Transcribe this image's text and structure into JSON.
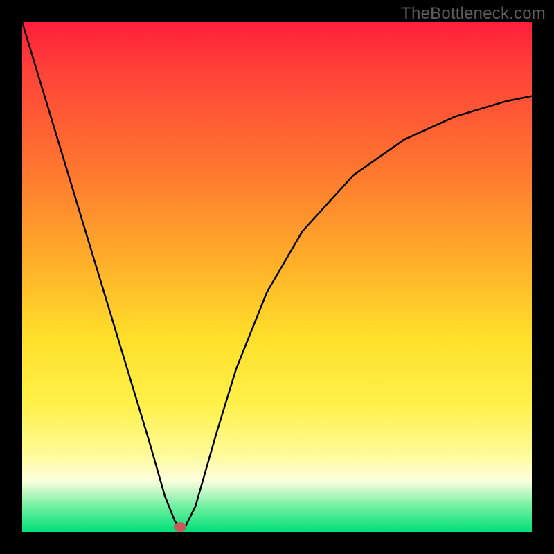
{
  "watermark": "TheBottleneck.com",
  "marker": {
    "x_frac": 0.31,
    "y_frac": 0.99
  },
  "chart_data": {
    "type": "line",
    "title": "",
    "xlabel": "",
    "ylabel": "",
    "xlim": [
      0,
      1
    ],
    "ylim": [
      0,
      1
    ],
    "series": [
      {
        "name": "curve",
        "x": [
          0.0,
          0.05,
          0.1,
          0.15,
          0.2,
          0.25,
          0.28,
          0.3,
          0.31,
          0.32,
          0.34,
          0.38,
          0.42,
          0.48,
          0.55,
          0.65,
          0.75,
          0.85,
          0.95,
          1.0
        ],
        "y": [
          1.0,
          0.835,
          0.67,
          0.505,
          0.34,
          0.175,
          0.07,
          0.02,
          0.01,
          0.01,
          0.05,
          0.19,
          0.32,
          0.47,
          0.59,
          0.7,
          0.77,
          0.815,
          0.845,
          0.855
        ]
      }
    ],
    "annotations": [
      {
        "type": "point",
        "x": 0.31,
        "y": 0.01,
        "label": "marker"
      }
    ]
  }
}
